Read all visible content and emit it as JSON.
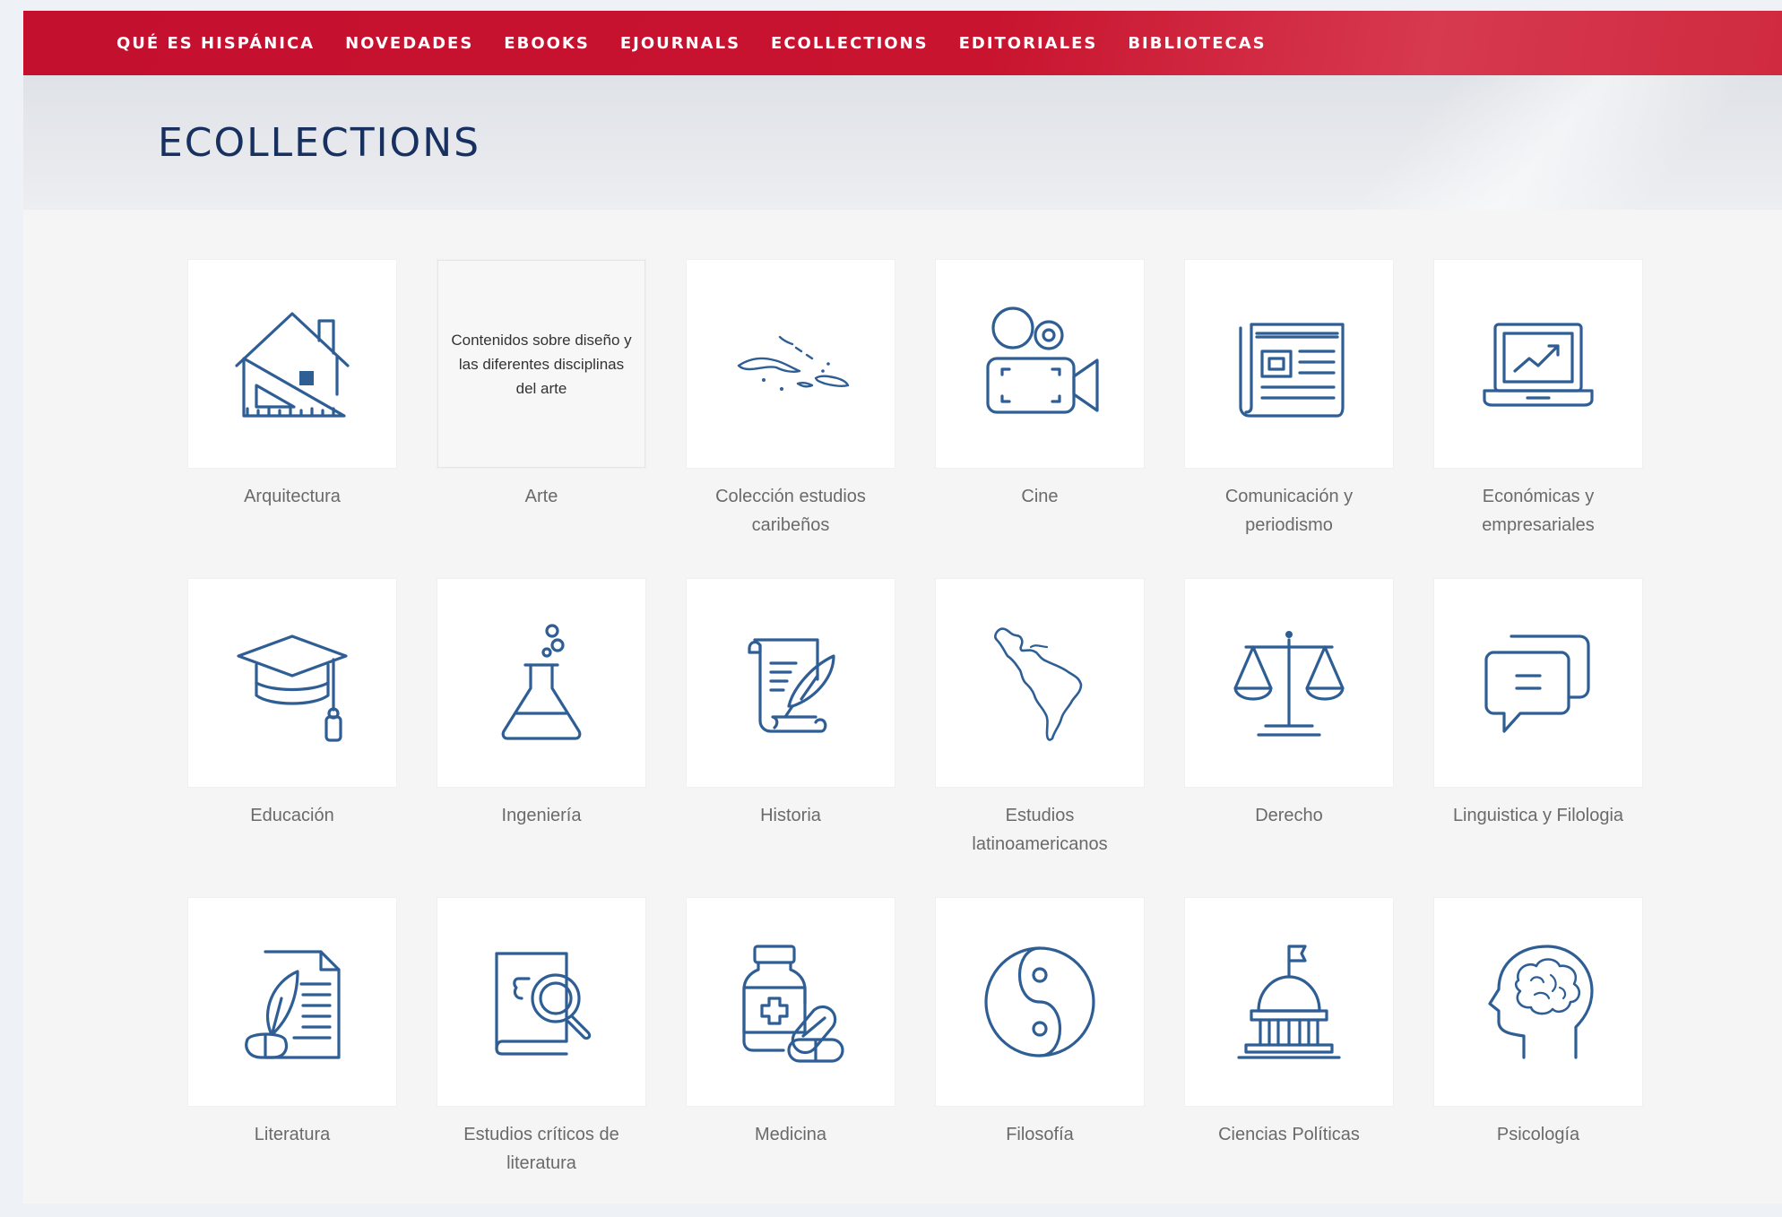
{
  "nav": {
    "items": [
      "QUÉ ES HISPÁNICA",
      "NOVEDADES",
      "EBOOKS",
      "EJOURNALS",
      "ECOLLECTIONS",
      "EDITORIALES",
      "BIBLIOTECAS"
    ]
  },
  "page": {
    "title": "ECOLLECTIONS"
  },
  "icon_color": "#2f5e95",
  "nav_color": "#c8142f",
  "collections": [
    {
      "label": "Arquitectura",
      "icon": "house-triangle-ruler-icon"
    },
    {
      "label": "Arte",
      "card_text": "Contenidos sobre diseño y las diferentes disciplinas del arte"
    },
    {
      "label": "Colección estudios caribeños",
      "icon": "caribbean-map-icon"
    },
    {
      "label": "Cine",
      "icon": "film-camera-icon"
    },
    {
      "label": "Comunicación y periodismo",
      "icon": "newspaper-icon"
    },
    {
      "label": "Económicas y empresariales",
      "icon": "laptop-chart-icon"
    },
    {
      "label": "Educación",
      "icon": "graduation-cap-icon"
    },
    {
      "label": "Ingeniería",
      "icon": "flask-icon"
    },
    {
      "label": "Historia",
      "icon": "scroll-quill-icon"
    },
    {
      "label": "Estudios latinoamericanos",
      "icon": "latin-america-map-icon"
    },
    {
      "label": "Derecho",
      "icon": "scales-of-justice-icon"
    },
    {
      "label": "Linguistica y Filologia",
      "icon": "speech-bubbles-icon"
    },
    {
      "label": "Literatura",
      "icon": "quill-document-icon"
    },
    {
      "label": "Estudios críticos de literatura",
      "icon": "book-magnifier-icon"
    },
    {
      "label": "Medicina",
      "icon": "medicine-pills-icon"
    },
    {
      "label": "Filosofía",
      "icon": "yin-yang-icon"
    },
    {
      "label": "Ciencias Políticas",
      "icon": "capitol-building-icon"
    },
    {
      "label": "Psicología",
      "icon": "head-brain-icon"
    }
  ]
}
